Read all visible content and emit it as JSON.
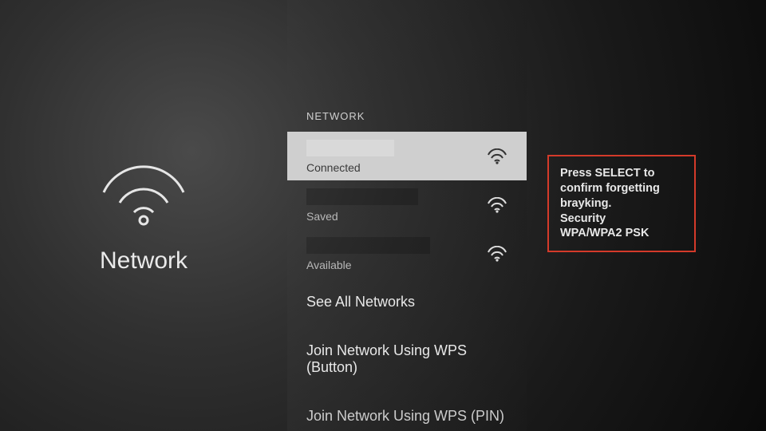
{
  "left": {
    "title": "Network"
  },
  "mid": {
    "header": "NETWORK",
    "networks": [
      {
        "status": "Connected"
      },
      {
        "status": "Saved"
      },
      {
        "status": "Available"
      }
    ],
    "options": {
      "see_all": "See All Networks",
      "wps_button": "Join Network Using WPS (Button)",
      "wps_pin": "Join Network Using WPS (PIN)"
    }
  },
  "info": {
    "line1": "Press SELECT to confirm forgetting brayking.",
    "security_label": "Security",
    "security_value": "WPA/WPA2 PSK"
  }
}
